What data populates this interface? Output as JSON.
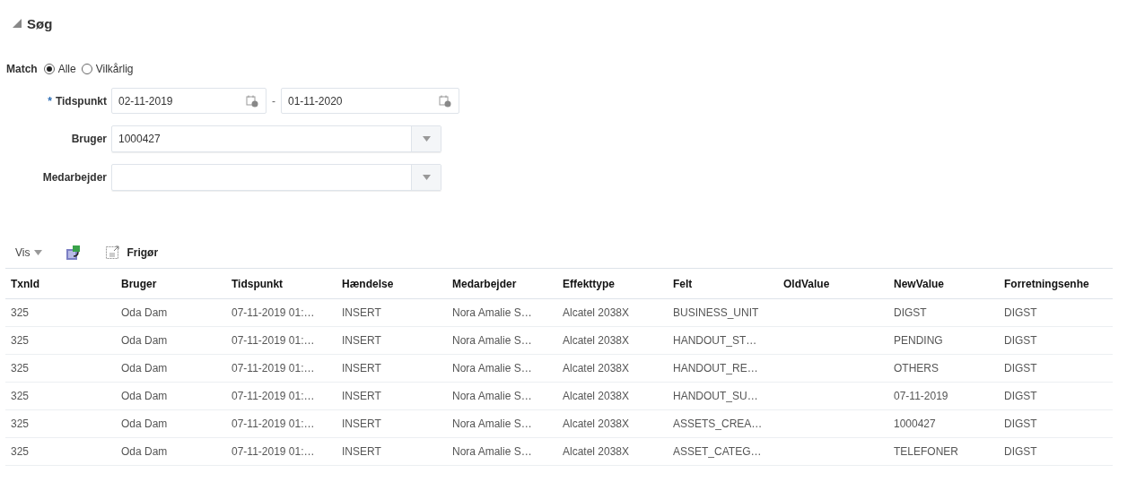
{
  "section": {
    "title": "Søg",
    "expanded": true
  },
  "match": {
    "label": "Match",
    "options": [
      {
        "label": "Alle",
        "selected": true
      },
      {
        "label": "Vilkårlig",
        "selected": false
      }
    ]
  },
  "fields": [
    {
      "kind": "daterange",
      "required_mark": "*",
      "label": "Tidspunkt",
      "from": "02-11-2019",
      "to": "01-11-2020",
      "separator": "-"
    },
    {
      "kind": "select",
      "label": "Bruger",
      "value": "1000427"
    },
    {
      "kind": "select",
      "label": "Medarbejder"
    }
  ],
  "toolbar": {
    "view_label": "Vis",
    "detach_label": "Frigør"
  },
  "table": {
    "columns": [
      "TxnId",
      "Bruger",
      "Tidspunkt",
      "Hændelse",
      "Medarbejder",
      "Effekttype",
      "Felt",
      "OldValue",
      "NewValue",
      "Forretningsenhe"
    ],
    "rows": [
      [
        "325",
        "Oda Dam",
        "07-11-2019 01:…",
        "INSERT",
        "Nora Amalie S…",
        "Alcatel 2038X",
        "BUSINESS_UNIT",
        "",
        "DIGST",
        "DIGST"
      ],
      [
        "325",
        "Oda Dam",
        "07-11-2019 01:…",
        "INSERT",
        "Nora Amalie S…",
        "Alcatel 2038X",
        "HANDOUT_ST…",
        "",
        "PENDING",
        "DIGST"
      ],
      [
        "325",
        "Oda Dam",
        "07-11-2019 01:…",
        "INSERT",
        "Nora Amalie S…",
        "Alcatel 2038X",
        "HANDOUT_RE…",
        "",
        "OTHERS",
        "DIGST"
      ],
      [
        "325",
        "Oda Dam",
        "07-11-2019 01:…",
        "INSERT",
        "Nora Amalie S…",
        "Alcatel 2038X",
        "HANDOUT_SU…",
        "",
        "07-11-2019",
        "DIGST"
      ],
      [
        "325",
        "Oda Dam",
        "07-11-2019 01:…",
        "INSERT",
        "Nora Amalie S…",
        "Alcatel 2038X",
        "ASSETS_CREA…",
        "",
        "1000427",
        "DIGST"
      ],
      [
        "325",
        "Oda Dam",
        "07-11-2019 01:…",
        "INSERT",
        "Nora Amalie S…",
        "Alcatel 2038X",
        "ASSET_CATEG…",
        "",
        "TELEFONER",
        "DIGST"
      ]
    ]
  }
}
